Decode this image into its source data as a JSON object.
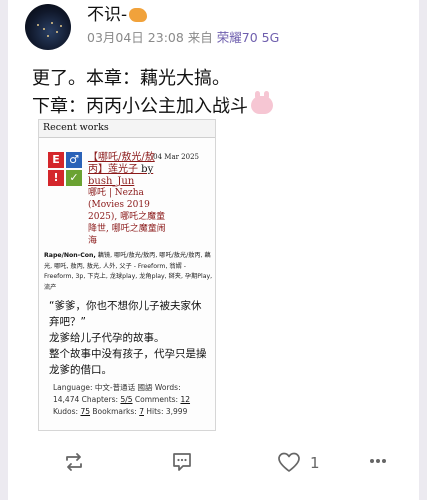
{
  "post": {
    "author": "不识-",
    "date": "03月04日 23:08",
    "source_prefix": "来自",
    "device": "荣耀70 5G",
    "line1": "更了。本章：藕光大搞。",
    "line2": "下章：丙丙小公主加入战斗"
  },
  "screenshot": {
    "header": "Recent works",
    "title": "【哪吒/敖光/敖丙】莲光子",
    "by": " by ",
    "author": "bush_Jun",
    "date": "04 Mar 2025",
    "fandom": "哪吒 | Nezha (Movies 2019 2025), 哪吒之魔童降世, 哪吒之魔童闹海",
    "warning": "Rape/Non-Con,",
    "tags": " 藕镜, 哪吒/敖光/敖丙, 哪吒/敖光/敖丙, 藕光, 哪吒, 敖丙, 敖光, 人外, 父子 - Freeform, 翁婿 - Freeform, 3p, 下克上, 龙球play, 龙角play, 掰夹, 孕期Play, 流产",
    "summary_1": "“爹爹，你也不想你儿子被夫家休弃吧？”",
    "summary_2": "龙爹给儿子代孕的故事。",
    "summary_3": "整个故事中没有孩子，代孕只是操龙爹的借口。",
    "stats_language": "Language: 中文-普通话 國語  Words: 14,474  Chapters: ",
    "stats_chapters": "5/5",
    "stats_comments_label": "  Comments: ",
    "stats_comments": "12",
    "stats_kudos_label": "  Kudos: ",
    "stats_kudos": "75",
    "stats_bookmarks_label": "  Bookmarks: ",
    "stats_bookmarks": "7",
    "stats_hits": "  Hits: 3,999"
  },
  "actions": {
    "like_count": "1"
  },
  "icons": [
    "repost-icon",
    "comment-icon",
    "heart-icon",
    "more-icon",
    "emoji-icon",
    "bunny-emoji-icon"
  ],
  "colors": {
    "device": "#6f5fae",
    "link": "#8b1a1a"
  }
}
